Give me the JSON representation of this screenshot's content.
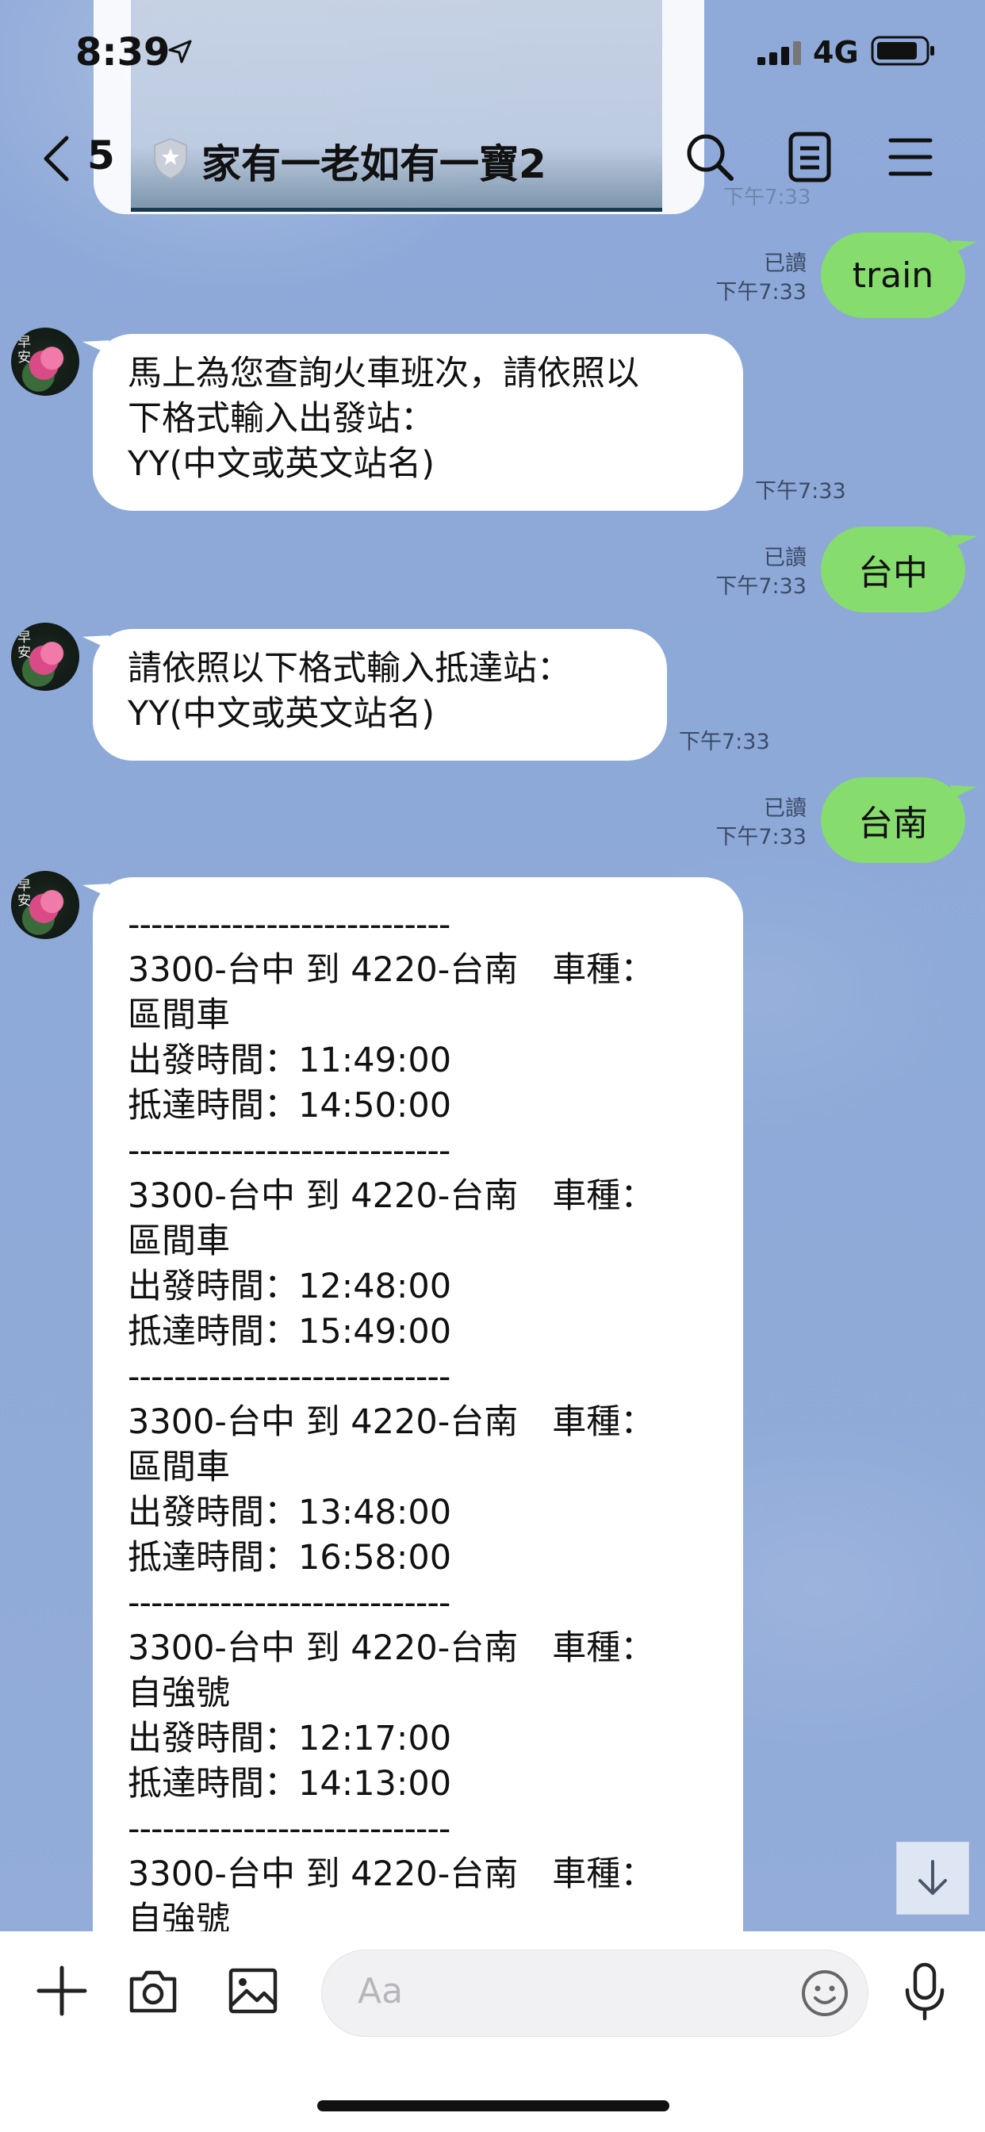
{
  "status_bar": {
    "time": "8:39",
    "network": "4G"
  },
  "header": {
    "back_count": "5",
    "title": "家有一老如有一寶2"
  },
  "ghost_time": "下午7:33",
  "messages": [
    {
      "read": "已讀",
      "time": "下午7:33",
      "text": "train"
    },
    {
      "text": "馬上為您查詢火車班次，請依照以\n下格式輸入出發站：\nYY(中文或英文站名)",
      "time": "下午7:33"
    },
    {
      "read": "已讀",
      "time": "下午7:33",
      "text": "台中"
    },
    {
      "text": "請依照以下格式輸入抵達站：\nYY(中文或英文站名)",
      "time": "下午7:33"
    },
    {
      "read": "已讀",
      "time": "下午7:33",
      "text": "台南"
    }
  ],
  "avatar_text": "早安",
  "train_results": {
    "divider": "----------------------------",
    "entries": [
      {
        "route": "3300-台中 到 4220-台南　車種：",
        "type": "區間車",
        "depart": "出發時間：11:49:00",
        "arrive": "抵達時間：14:50:00"
      },
      {
        "route": "3300-台中 到 4220-台南　車種：",
        "type": "區間車",
        "depart": "出發時間：12:48:00",
        "arrive": "抵達時間：15:49:00"
      },
      {
        "route": "3300-台中 到 4220-台南　車種：",
        "type": "區間車",
        "depart": "出發時間：13:48:00",
        "arrive": "抵達時間：16:58:00"
      },
      {
        "route": "3300-台中 到 4220-台南　車種：",
        "type": "自強號",
        "depart": "出發時間：12:17:00",
        "arrive": "抵達時間：14:13:00"
      },
      {
        "route": "3300-台中 到 4220-台南　車種：",
        "type": "自強號"
      }
    ]
  },
  "input": {
    "placeholder": "Aa"
  },
  "colors": {
    "outgoing_bubble": "#86dc6c",
    "chat_background": "#8da9d8"
  }
}
